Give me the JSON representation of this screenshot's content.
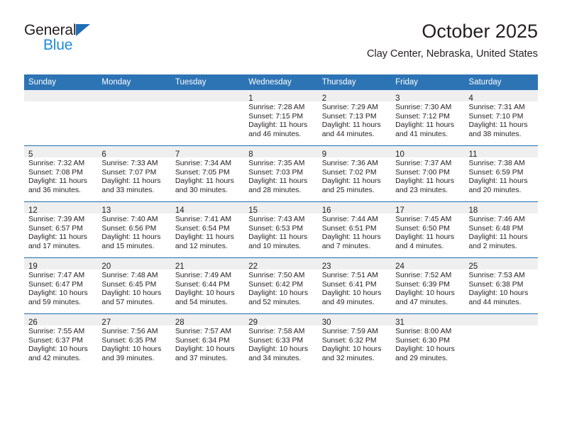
{
  "logo": {
    "word1": "General",
    "word2": "Blue",
    "triangle_color": "#1f6eb5",
    "word2_color": "#1f8ada"
  },
  "header": {
    "title": "October 2025",
    "subtitle": "Clay Center, Nebraska, United States"
  },
  "theme": {
    "header_bg": "#2d74b5",
    "header_text": "#ffffff",
    "row_divider": "#1f6eb5",
    "daynum_band": "#efefef",
    "body_text": "#231f20"
  },
  "weekday_headers": [
    "Sunday",
    "Monday",
    "Tuesday",
    "Wednesday",
    "Thursday",
    "Friday",
    "Saturday"
  ],
  "labels": {
    "sunrise": "Sunrise:",
    "sunset": "Sunset:",
    "daylight": "Daylight:"
  },
  "weeks": [
    [
      {
        "day": "",
        "line1": "",
        "line2": "",
        "line3": "",
        "line4": ""
      },
      {
        "day": "",
        "line1": "",
        "line2": "",
        "line3": "",
        "line4": ""
      },
      {
        "day": "",
        "line1": "",
        "line2": "",
        "line3": "",
        "line4": ""
      },
      {
        "day": "1",
        "line1": "Sunrise: 7:28 AM",
        "line2": "Sunset: 7:15 PM",
        "line3": "Daylight: 11 hours",
        "line4": "and 46 minutes."
      },
      {
        "day": "2",
        "line1": "Sunrise: 7:29 AM",
        "line2": "Sunset: 7:13 PM",
        "line3": "Daylight: 11 hours",
        "line4": "and 44 minutes."
      },
      {
        "day": "3",
        "line1": "Sunrise: 7:30 AM",
        "line2": "Sunset: 7:12 PM",
        "line3": "Daylight: 11 hours",
        "line4": "and 41 minutes."
      },
      {
        "day": "4",
        "line1": "Sunrise: 7:31 AM",
        "line2": "Sunset: 7:10 PM",
        "line3": "Daylight: 11 hours",
        "line4": "and 38 minutes."
      }
    ],
    [
      {
        "day": "5",
        "line1": "Sunrise: 7:32 AM",
        "line2": "Sunset: 7:08 PM",
        "line3": "Daylight: 11 hours",
        "line4": "and 36 minutes."
      },
      {
        "day": "6",
        "line1": "Sunrise: 7:33 AM",
        "line2": "Sunset: 7:07 PM",
        "line3": "Daylight: 11 hours",
        "line4": "and 33 minutes."
      },
      {
        "day": "7",
        "line1": "Sunrise: 7:34 AM",
        "line2": "Sunset: 7:05 PM",
        "line3": "Daylight: 11 hours",
        "line4": "and 30 minutes."
      },
      {
        "day": "8",
        "line1": "Sunrise: 7:35 AM",
        "line2": "Sunset: 7:03 PM",
        "line3": "Daylight: 11 hours",
        "line4": "and 28 minutes."
      },
      {
        "day": "9",
        "line1": "Sunrise: 7:36 AM",
        "line2": "Sunset: 7:02 PM",
        "line3": "Daylight: 11 hours",
        "line4": "and 25 minutes."
      },
      {
        "day": "10",
        "line1": "Sunrise: 7:37 AM",
        "line2": "Sunset: 7:00 PM",
        "line3": "Daylight: 11 hours",
        "line4": "and 23 minutes."
      },
      {
        "day": "11",
        "line1": "Sunrise: 7:38 AM",
        "line2": "Sunset: 6:59 PM",
        "line3": "Daylight: 11 hours",
        "line4": "and 20 minutes."
      }
    ],
    [
      {
        "day": "12",
        "line1": "Sunrise: 7:39 AM",
        "line2": "Sunset: 6:57 PM",
        "line3": "Daylight: 11 hours",
        "line4": "and 17 minutes."
      },
      {
        "day": "13",
        "line1": "Sunrise: 7:40 AM",
        "line2": "Sunset: 6:56 PM",
        "line3": "Daylight: 11 hours",
        "line4": "and 15 minutes."
      },
      {
        "day": "14",
        "line1": "Sunrise: 7:41 AM",
        "line2": "Sunset: 6:54 PM",
        "line3": "Daylight: 11 hours",
        "line4": "and 12 minutes."
      },
      {
        "day": "15",
        "line1": "Sunrise: 7:43 AM",
        "line2": "Sunset: 6:53 PM",
        "line3": "Daylight: 11 hours",
        "line4": "and 10 minutes."
      },
      {
        "day": "16",
        "line1": "Sunrise: 7:44 AM",
        "line2": "Sunset: 6:51 PM",
        "line3": "Daylight: 11 hours",
        "line4": "and 7 minutes."
      },
      {
        "day": "17",
        "line1": "Sunrise: 7:45 AM",
        "line2": "Sunset: 6:50 PM",
        "line3": "Daylight: 11 hours",
        "line4": "and 4 minutes."
      },
      {
        "day": "18",
        "line1": "Sunrise: 7:46 AM",
        "line2": "Sunset: 6:48 PM",
        "line3": "Daylight: 11 hours",
        "line4": "and 2 minutes."
      }
    ],
    [
      {
        "day": "19",
        "line1": "Sunrise: 7:47 AM",
        "line2": "Sunset: 6:47 PM",
        "line3": "Daylight: 10 hours",
        "line4": "and 59 minutes."
      },
      {
        "day": "20",
        "line1": "Sunrise: 7:48 AM",
        "line2": "Sunset: 6:45 PM",
        "line3": "Daylight: 10 hours",
        "line4": "and 57 minutes."
      },
      {
        "day": "21",
        "line1": "Sunrise: 7:49 AM",
        "line2": "Sunset: 6:44 PM",
        "line3": "Daylight: 10 hours",
        "line4": "and 54 minutes."
      },
      {
        "day": "22",
        "line1": "Sunrise: 7:50 AM",
        "line2": "Sunset: 6:42 PM",
        "line3": "Daylight: 10 hours",
        "line4": "and 52 minutes."
      },
      {
        "day": "23",
        "line1": "Sunrise: 7:51 AM",
        "line2": "Sunset: 6:41 PM",
        "line3": "Daylight: 10 hours",
        "line4": "and 49 minutes."
      },
      {
        "day": "24",
        "line1": "Sunrise: 7:52 AM",
        "line2": "Sunset: 6:39 PM",
        "line3": "Daylight: 10 hours",
        "line4": "and 47 minutes."
      },
      {
        "day": "25",
        "line1": "Sunrise: 7:53 AM",
        "line2": "Sunset: 6:38 PM",
        "line3": "Daylight: 10 hours",
        "line4": "and 44 minutes."
      }
    ],
    [
      {
        "day": "26",
        "line1": "Sunrise: 7:55 AM",
        "line2": "Sunset: 6:37 PM",
        "line3": "Daylight: 10 hours",
        "line4": "and 42 minutes."
      },
      {
        "day": "27",
        "line1": "Sunrise: 7:56 AM",
        "line2": "Sunset: 6:35 PM",
        "line3": "Daylight: 10 hours",
        "line4": "and 39 minutes."
      },
      {
        "day": "28",
        "line1": "Sunrise: 7:57 AM",
        "line2": "Sunset: 6:34 PM",
        "line3": "Daylight: 10 hours",
        "line4": "and 37 minutes."
      },
      {
        "day": "29",
        "line1": "Sunrise: 7:58 AM",
        "line2": "Sunset: 6:33 PM",
        "line3": "Daylight: 10 hours",
        "line4": "and 34 minutes."
      },
      {
        "day": "30",
        "line1": "Sunrise: 7:59 AM",
        "line2": "Sunset: 6:32 PM",
        "line3": "Daylight: 10 hours",
        "line4": "and 32 minutes."
      },
      {
        "day": "31",
        "line1": "Sunrise: 8:00 AM",
        "line2": "Sunset: 6:30 PM",
        "line3": "Daylight: 10 hours",
        "line4": "and 29 minutes."
      },
      {
        "day": "",
        "line1": "",
        "line2": "",
        "line3": "",
        "line4": ""
      }
    ]
  ]
}
